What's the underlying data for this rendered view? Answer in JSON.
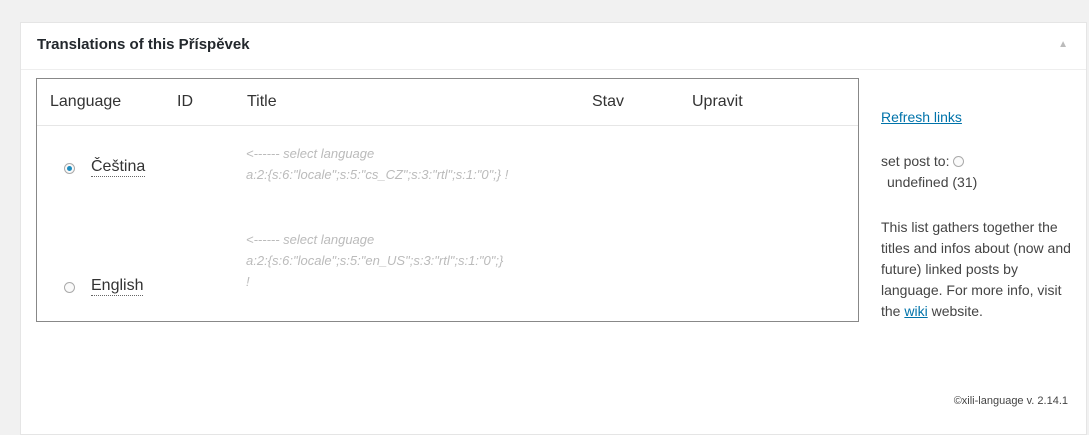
{
  "metabox": {
    "title": "Translations of this Příspěvek",
    "toggle_icon": "triangle-up-icon"
  },
  "table": {
    "headers": {
      "language": "Language",
      "id": "ID",
      "title": "Title",
      "status": "Stav",
      "edit": "Upravit"
    },
    "rows": [
      {
        "language": "Čeština",
        "selected": true,
        "hint_line1": "<------ select language",
        "hint_line2": "a:2:{s:6:\"locale\";s:5:\"cs_CZ\";s:3:\"rtl\";s:1:\"0\";} !",
        "hint_line3": ""
      },
      {
        "language": "English",
        "selected": false,
        "hint_line1": "<------ select language",
        "hint_line2": "a:2:{s:6:\"locale\";s:5:\"en_US\";s:3:\"rtl\";s:1:\"0\";}",
        "hint_line3": "!"
      }
    ]
  },
  "sidebar": {
    "refresh_link": "Refresh links",
    "set_post_label": "set post to:",
    "undefined_label": "undefined (31)",
    "info_text_before": "This list gathers together the titles and infos about (now and future) linked posts by language. For more info, visit the ",
    "wiki_link": "wiki",
    "info_text_after": " website."
  },
  "footer": {
    "version": "©xili-language v. 2.14.1"
  }
}
